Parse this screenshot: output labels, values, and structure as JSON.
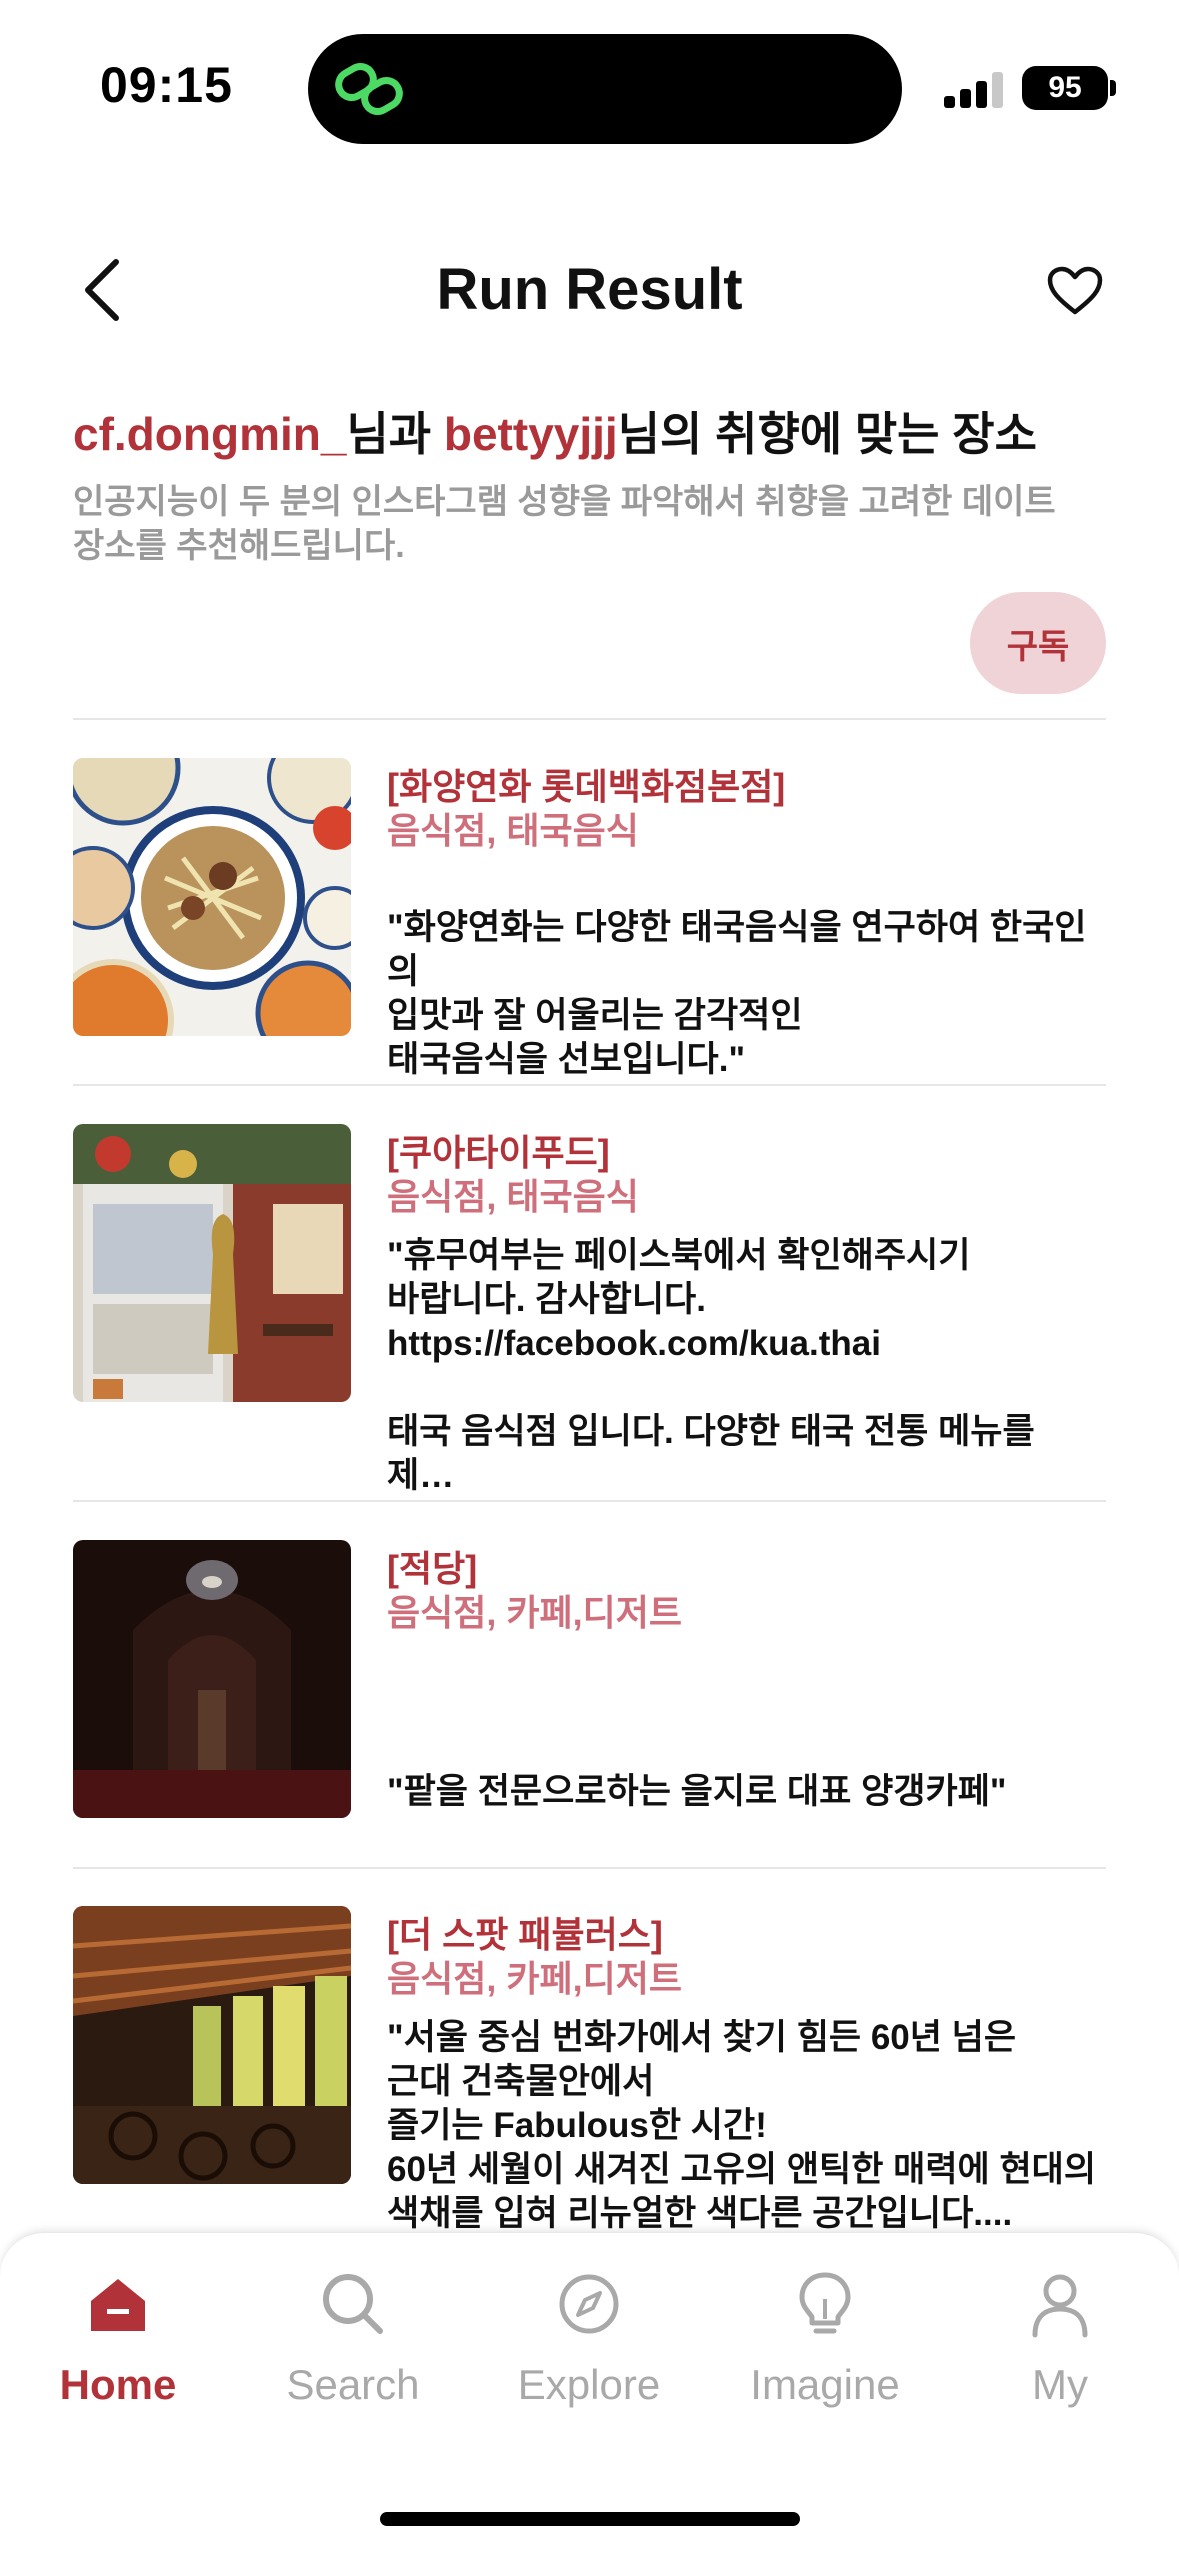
{
  "status_bar": {
    "time": "09:15",
    "battery": "95"
  },
  "header": {
    "title": "Run Result"
  },
  "intro": {
    "user1": "cf.dongmin_",
    "connector": "님과 ",
    "user2": "bettyyjjj",
    "suffix": "님의 취향에 맞는 장소",
    "subtitle": "인공지능이 두 분의 인스타그램 성향을 파악해서 취향을 고려한 데이트 장소를 추천해드립니다.",
    "subscribe_label": "구독"
  },
  "places": [
    {
      "name": "[화양연화 롯데백화점본점]",
      "category": "음식점, 태국음식",
      "description": "\"화양연화는 다양한 태국음식을 연구하여 한국인의\n입맛과 잘 어울리는 감각적인\n태국음식을 선보입니다.\""
    },
    {
      "name": "[쿠아타이푸드]",
      "category": "음식점, 태국음식",
      "description": "\"휴무여부는 페이스북에서 확인해주시기\n바랍니다. 감사합니다.\nhttps://facebook.com/kua.thai\n\n태국 음식점 입니다. 다양한 태국 전통 메뉴를 제…"
    },
    {
      "name": "[적당]",
      "category": "음식점, 카페,디저트",
      "description": "\"팥을 전문으로하는 을지로 대표 양갱카페\""
    },
    {
      "name": "[더 스팟 패뷸러스]",
      "category": "음식점, 카페,디저트",
      "description": "\"서울 중심 번화가에서 찾기 힘든 60년 넘은\n근대 건축물안에서\n즐기는 Fabulous한 시간!\n60년 세월이 새겨진 고유의 앤틱한 매력에 현대의\n색채를 입혀 리뉴얼한 색다른 공간입니다...."
    }
  ],
  "tabs": [
    {
      "label": "Home",
      "icon": "home-icon",
      "active": true
    },
    {
      "label": "Search",
      "icon": "search-icon",
      "active": false
    },
    {
      "label": "Explore",
      "icon": "compass-icon",
      "active": false
    },
    {
      "label": "Imagine",
      "icon": "lightbulb-icon",
      "active": false
    },
    {
      "label": "My",
      "icon": "person-icon",
      "active": false
    }
  ],
  "colors": {
    "accent": "#b2323a",
    "category": "#d06f7c",
    "subtitle": "#9a9a9a",
    "pill_bg": "#f0d3d6",
    "inactive_tab": "#a9a9a9"
  }
}
